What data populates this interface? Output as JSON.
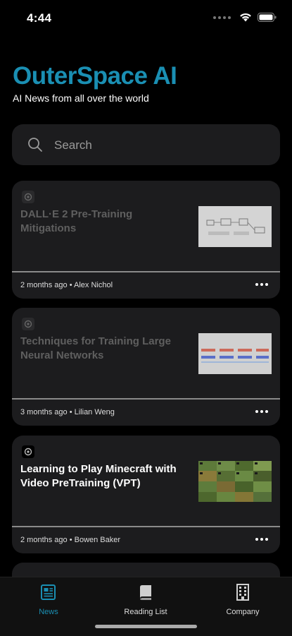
{
  "status": {
    "time": "4:44"
  },
  "header": {
    "title": "OuterSpace AI",
    "subtitle": "AI News from all over the world"
  },
  "search": {
    "placeholder": "Search"
  },
  "articles": [
    {
      "title": "DALL·E 2 Pre-Training Mitigations",
      "meta": "2 months ago • Alex Nichol",
      "active": false
    },
    {
      "title": "Techniques for Training Large Neural Networks",
      "meta": "3 months ago • Lilian Weng",
      "active": false
    },
    {
      "title": "Learning to Play Minecraft with Video PreTraining (VPT)",
      "meta": "2 months ago • Bowen Baker",
      "active": true
    }
  ],
  "tabs": [
    {
      "label": "News",
      "icon": "news-icon",
      "active": true
    },
    {
      "label": "Reading List",
      "icon": "book-icon",
      "active": false
    },
    {
      "label": "Company",
      "icon": "building-icon",
      "active": false
    }
  ],
  "colors": {
    "accent": "#1a8fb3",
    "background": "#000000",
    "card": "#1c1c1e"
  }
}
